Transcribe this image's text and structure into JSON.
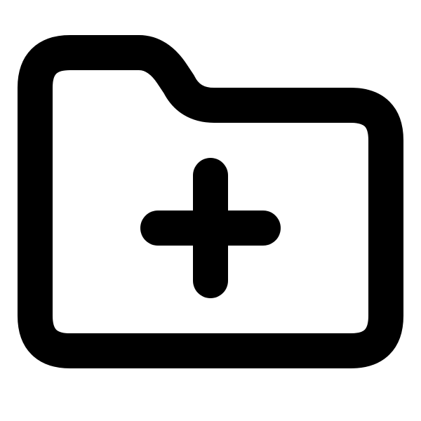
{
  "icon": {
    "name": "folder-plus-icon",
    "stroke_color": "#000000",
    "background_color": "#ffffff"
  }
}
